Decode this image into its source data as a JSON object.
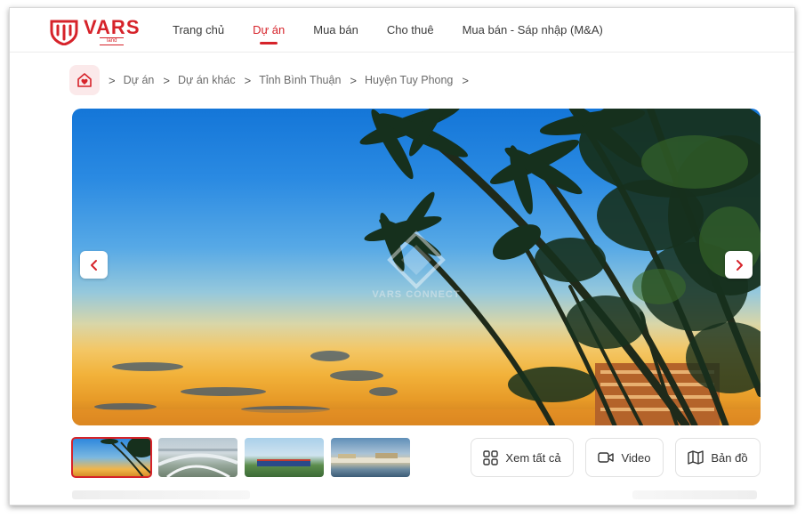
{
  "brand": {
    "name": "VARS",
    "tagline": "land",
    "color": "#d6232a"
  },
  "nav": {
    "items": [
      {
        "label": "Trang chủ",
        "active": false
      },
      {
        "label": "Dự án",
        "active": true
      },
      {
        "label": "Mua bán",
        "active": false
      },
      {
        "label": "Cho thuê",
        "active": false
      },
      {
        "label": "Mua bán - Sáp nhập (M&A)",
        "active": false
      }
    ]
  },
  "breadcrumb": {
    "home_icon": "home-heart-icon",
    "separator": ">",
    "items": [
      "Dự án",
      "Dự án khác",
      "Tỉnh Bình Thuận",
      "Huyện Tuy Phong"
    ]
  },
  "gallery": {
    "watermark": "VARS CONNECT",
    "prev_icon": "chevron-left-icon",
    "next_icon": "chevron-right-icon",
    "thumbnails": [
      {
        "name": "thumbnail-beach-palms",
        "selected": true
      },
      {
        "name": "thumbnail-highway-interchange",
        "selected": false
      },
      {
        "name": "thumbnail-train-field",
        "selected": false
      },
      {
        "name": "thumbnail-coastal-town",
        "selected": false
      }
    ]
  },
  "actions": {
    "view_all": "Xem tất cả",
    "video": "Video",
    "map": "Bản đồ"
  }
}
